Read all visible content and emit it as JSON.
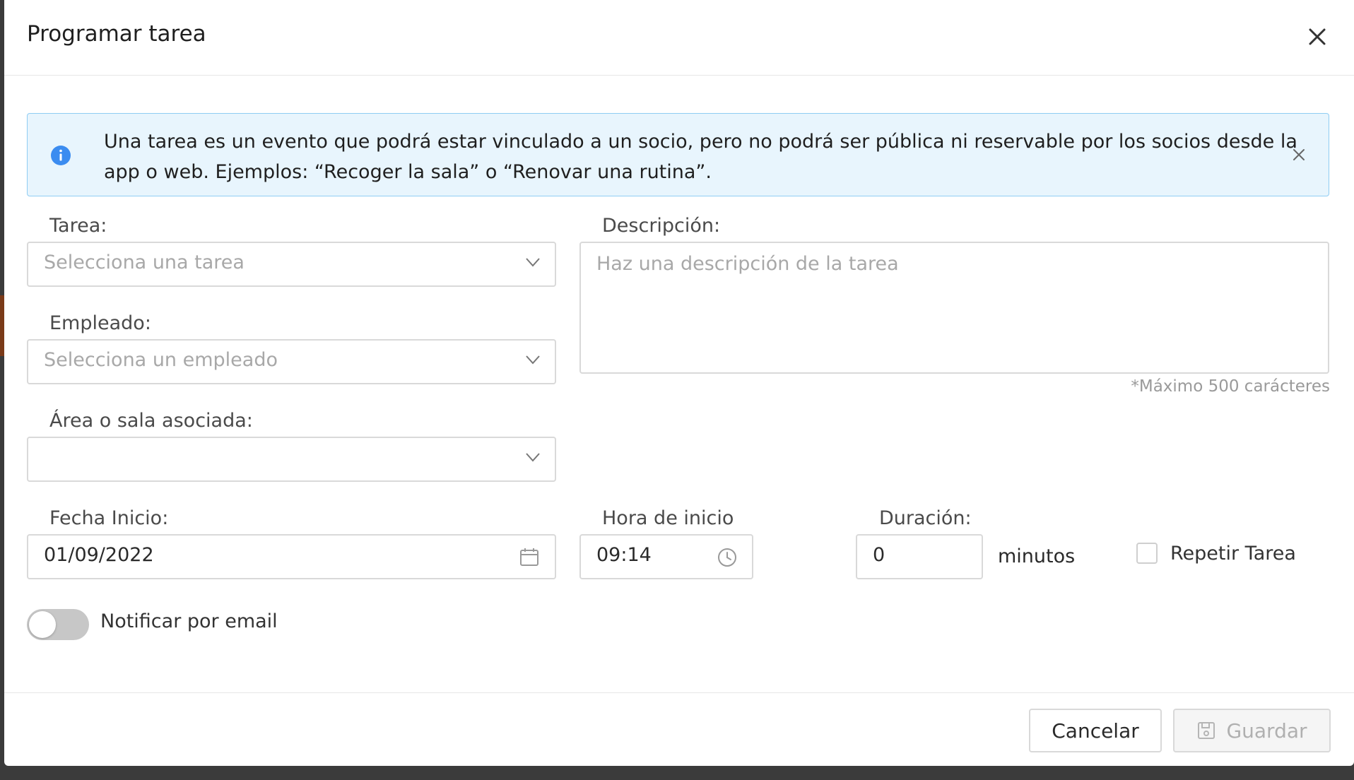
{
  "dialog": {
    "title": "Programar tarea"
  },
  "alert": {
    "text": "Una tarea es un evento que podrá estar vinculado a un socio, pero no podrá ser pública ni reservable por los socios desde la app o web. Ejemplos: “Recoger la sala” o “Renovar una rutina”."
  },
  "form": {
    "task": {
      "label": "Tarea:",
      "placeholder": "Selecciona una tarea"
    },
    "employee": {
      "label": "Empleado:",
      "placeholder": "Selecciona un empleado"
    },
    "area": {
      "label": "Área o sala asociada:",
      "value": ""
    },
    "description": {
      "label": "Descripción:",
      "placeholder": "Haz una descripción de la tarea",
      "hint": "*Máximo 500 carácteres"
    },
    "start_date": {
      "label": "Fecha Inicio:",
      "value": "01/09/2022"
    },
    "start_time": {
      "label": "Hora de inicio",
      "value": "09:14"
    },
    "duration": {
      "label": "Duración:",
      "value": "0",
      "unit": "minutos"
    },
    "repeat": {
      "label": "Repetir Tarea",
      "checked": false
    },
    "notify": {
      "label": "Notificar por email",
      "enabled": false
    }
  },
  "footer": {
    "cancel_label": "Cancelar",
    "save_label": "Guardar"
  },
  "colors": {
    "alert_bg": "#e8f5fd",
    "alert_border": "#8fcdf3",
    "info_icon": "#3b8cf0"
  }
}
